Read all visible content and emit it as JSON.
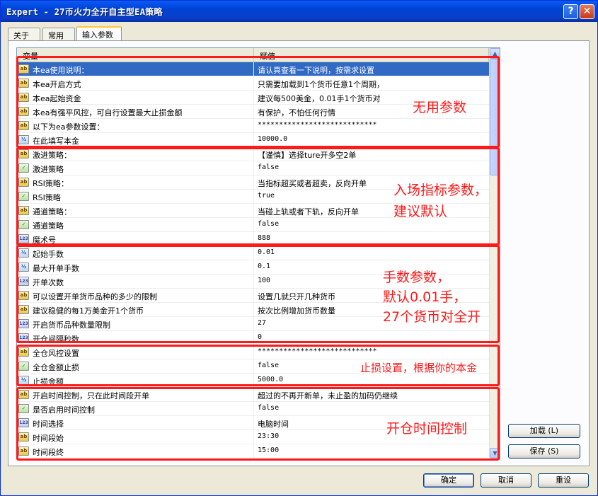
{
  "window": {
    "title": "Expert - 27币火力全开自主型EA策略",
    "help_glyph": "?",
    "close_glyph": "✕"
  },
  "tabs": [
    {
      "label": "关于"
    },
    {
      "label": "常用"
    },
    {
      "label": "输入参数",
      "active": true
    }
  ],
  "grid": {
    "col_variable": "变量",
    "col_value": "赋值",
    "rows": [
      {
        "type": "ab",
        "name": "本ea使用说明：",
        "value": "请认真查看一下说明，按需求设置",
        "selected": true
      },
      {
        "type": "ab",
        "name": "本ea开启方式",
        "value": "只需要加载到1个货币任意1个周期，"
      },
      {
        "type": "ab",
        "name": "本ea起始资金",
        "value": "建议每500美金，0.01手1个货币对"
      },
      {
        "type": "ab",
        "name": "本ea有强平风控，可自行设置最大止损金额",
        "value": "有保护，不怕任何行情"
      },
      {
        "type": "ab",
        "name": "以下为ea参数设置：",
        "value": "****************************"
      },
      {
        "type": "dbl",
        "name": "在此填写本金",
        "value": "10000.0"
      },
      {
        "type": "ab",
        "name": "激进策略：",
        "value": "【谨慎】选择ture开多空2单"
      },
      {
        "type": "bool",
        "name": "激进策略",
        "value": "false"
      },
      {
        "type": "ab",
        "name": "RSI策略：",
        "value": "当指标超买或者超卖，反向开单"
      },
      {
        "type": "bool",
        "name": "RSI策略",
        "value": "true"
      },
      {
        "type": "ab",
        "name": "通道策略：",
        "value": "当碰上轨或者下轨，反向开单"
      },
      {
        "type": "bool",
        "name": "通道策略",
        "value": "false"
      },
      {
        "type": "int",
        "name": "魔术号",
        "value": "888"
      },
      {
        "type": "dbl",
        "name": "起始手数",
        "value": "0.01"
      },
      {
        "type": "dbl",
        "name": "最大开单手数",
        "value": "0.1"
      },
      {
        "type": "int",
        "name": "开单次数",
        "value": "100"
      },
      {
        "type": "ab",
        "name": "可以设置开单货币品种的多少的限制",
        "value": "设置几就只开几种货币"
      },
      {
        "type": "ab",
        "name": "建议稳健的每1万美金开1个货币",
        "value": "按次比例增加货币数量"
      },
      {
        "type": "int",
        "name": "开启货币品种数量限制",
        "value": "27"
      },
      {
        "type": "int",
        "name": "开仓间隔秒数",
        "value": "0"
      },
      {
        "type": "ab",
        "name": "全仓风控设置",
        "value": "****************************"
      },
      {
        "type": "bool",
        "name": "全仓金额止损",
        "value": "false"
      },
      {
        "type": "dbl",
        "name": "止损金额",
        "value": "5000.0"
      },
      {
        "type": "ab",
        "name": "开启时间控制，只在此时间段开单",
        "value": "超过的不再开新单，未止盈的加码仍继续"
      },
      {
        "type": "bool",
        "name": "是否启用时间控制",
        "value": "false"
      },
      {
        "type": "int",
        "name": "时间选择",
        "value": "电脑时间"
      },
      {
        "type": "ab",
        "name": "时间段始",
        "value": "23:30"
      },
      {
        "type": "ab",
        "name": "时间段终",
        "value": "15:00"
      }
    ]
  },
  "type_icons": {
    "ab": "ab",
    "bool": "✓",
    "dbl": "½",
    "int": "123"
  },
  "annotations": {
    "group1": "无用参数",
    "group2_line1": "入场指标参数，",
    "group2_line2": "建议默认",
    "group3_line1": "手数参数，",
    "group3_line2": "默认0.01手，",
    "group3_line3": "27个货币对全开",
    "group4": "止损设置，根据你的本金",
    "group5": "开仓时间控制",
    "color": "#ff1a1a"
  },
  "side_buttons": {
    "load": "加载 (L)",
    "save": "保存 (S)"
  },
  "footer_buttons": {
    "ok": "确定",
    "cancel": "取消",
    "reset": "重设"
  },
  "scroll": {
    "up_glyph": "▲",
    "down_glyph": "▼"
  }
}
